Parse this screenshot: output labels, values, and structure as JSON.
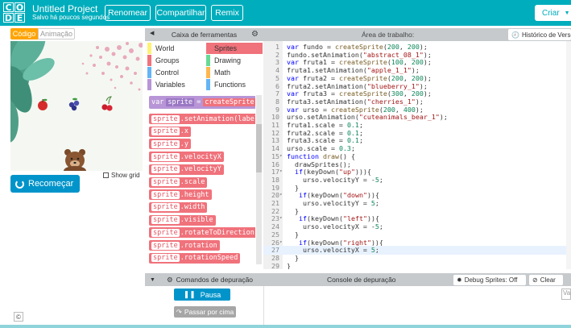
{
  "header": {
    "logo_letters": [
      "C",
      "O",
      "D",
      "E"
    ],
    "project_title": "Untitled Project",
    "project_status": "Salvo há poucos segundos",
    "buttons": {
      "renomear": "Renomear",
      "compartilhar": "Compartilhar",
      "remix": "Remix"
    },
    "create_label": "Criar"
  },
  "left": {
    "tab_code": "Código",
    "tab_animation": "Animação",
    "show_grid": "Show grid",
    "reset": "Recomeçar",
    "copyright": "©"
  },
  "toolbox": {
    "title": "Caixa de ferramentas",
    "categories": [
      {
        "label": "World",
        "color": "#fff176"
      },
      {
        "label": "Sprites",
        "color": "#f0727b"
      },
      {
        "label": "Groups",
        "color": "#f0727b"
      },
      {
        "label": "Drawing",
        "color": "#68d995"
      },
      {
        "label": "Control",
        "color": "#64b5f6"
      },
      {
        "label": "Math",
        "color": "#ffb74d"
      },
      {
        "label": "Variables",
        "color": "#b795d6"
      },
      {
        "label": "Functions",
        "color": "#64b5f6"
      }
    ],
    "var_block": {
      "keyword": "var",
      "name": "sprite",
      "eq": "=",
      "call": "createSprite("
    },
    "blocks": [
      {
        "obj": "sprite",
        "rest": ".setAnimation(label)"
      },
      {
        "obj": "sprite",
        "rest": ".x"
      },
      {
        "obj": "sprite",
        "rest": ".y"
      },
      {
        "obj": "sprite",
        "rest": ".velocityX"
      },
      {
        "obj": "sprite",
        "rest": ".velocityY"
      },
      {
        "obj": "sprite",
        "rest": ".scale"
      },
      {
        "obj": "sprite",
        "rest": ".height"
      },
      {
        "obj": "sprite",
        "rest": ".width"
      },
      {
        "obj": "sprite",
        "rest": ".visible"
      },
      {
        "obj": "sprite",
        "rest": ".rotateToDirection"
      },
      {
        "obj": "sprite",
        "rest": ".rotation"
      },
      {
        "obj": "sprite",
        "rest": ".rotationSpeed"
      }
    ]
  },
  "workspace": {
    "title": "Área de trabalho:",
    "history": "Histórico de Versões",
    "active_line": 27,
    "lines": [
      {
        "n": "1",
        "fold": "",
        "code": [
          [
            "k",
            "var"
          ],
          [
            "t",
            " fundo = "
          ],
          [
            "f",
            "createSprite"
          ],
          [
            "t",
            "("
          ],
          [
            "n",
            "200"
          ],
          [
            "t",
            ", "
          ],
          [
            "n",
            "200"
          ],
          [
            "t",
            ");"
          ]
        ]
      },
      {
        "n": "2",
        "fold": "",
        "code": [
          [
            "t",
            "fundo.setAnimation("
          ],
          [
            "s",
            "\"abstract_08_1\""
          ],
          [
            "t",
            ");"
          ]
        ]
      },
      {
        "n": "3",
        "fold": "",
        "code": [
          [
            "k",
            "var"
          ],
          [
            "t",
            " fruta1 = "
          ],
          [
            "f",
            "createSprite"
          ],
          [
            "t",
            "("
          ],
          [
            "n",
            "100"
          ],
          [
            "t",
            ", "
          ],
          [
            "n",
            "200"
          ],
          [
            "t",
            ");"
          ]
        ]
      },
      {
        "n": "4",
        "fold": "",
        "code": [
          [
            "t",
            "fruta1.setAnimation("
          ],
          [
            "s",
            "\"apple_1_1\""
          ],
          [
            "t",
            ");"
          ]
        ]
      },
      {
        "n": "5",
        "fold": "",
        "code": [
          [
            "k",
            "var"
          ],
          [
            "t",
            " fruta2 = "
          ],
          [
            "f",
            "createSprite"
          ],
          [
            "t",
            "("
          ],
          [
            "n",
            "200"
          ],
          [
            "t",
            ", "
          ],
          [
            "n",
            "200"
          ],
          [
            "t",
            ");"
          ]
        ]
      },
      {
        "n": "6",
        "fold": "",
        "code": [
          [
            "t",
            "fruta2.setAnimation("
          ],
          [
            "s",
            "\"blueberry_1\""
          ],
          [
            "t",
            ");"
          ]
        ]
      },
      {
        "n": "7",
        "fold": "",
        "code": [
          [
            "k",
            "var"
          ],
          [
            "t",
            " fruta3 = "
          ],
          [
            "f",
            "createSprite"
          ],
          [
            "t",
            "("
          ],
          [
            "n",
            "300"
          ],
          [
            "t",
            ", "
          ],
          [
            "n",
            "200"
          ],
          [
            "t",
            ");"
          ]
        ]
      },
      {
        "n": "8",
        "fold": "",
        "code": [
          [
            "t",
            "fruta3.setAnimation("
          ],
          [
            "s",
            "\"cherries_1\""
          ],
          [
            "t",
            ");"
          ]
        ]
      },
      {
        "n": "9",
        "fold": "",
        "code": [
          [
            "k",
            "var"
          ],
          [
            "t",
            " urso = "
          ],
          [
            "f",
            "createSprite"
          ],
          [
            "t",
            "("
          ],
          [
            "n",
            "200"
          ],
          [
            "t",
            ", "
          ],
          [
            "n",
            "400"
          ],
          [
            "t",
            ");"
          ]
        ]
      },
      {
        "n": "10",
        "fold": "",
        "code": [
          [
            "t",
            "urso.setAnimation("
          ],
          [
            "s",
            "\"cuteanimals_bear_1\""
          ],
          [
            "t",
            ");"
          ]
        ]
      },
      {
        "n": "11",
        "fold": "",
        "code": [
          [
            "t",
            "fruta1.scale = "
          ],
          [
            "n",
            "0.1"
          ],
          [
            "t",
            ";"
          ]
        ]
      },
      {
        "n": "12",
        "fold": "",
        "code": [
          [
            "t",
            "fruta2.scale = "
          ],
          [
            "n",
            "0.1"
          ],
          [
            "t",
            ";"
          ]
        ]
      },
      {
        "n": "13",
        "fold": "",
        "code": [
          [
            "t",
            "fruta3.scale = "
          ],
          [
            "n",
            "0.1"
          ],
          [
            "t",
            ";"
          ]
        ]
      },
      {
        "n": "14",
        "fold": "",
        "code": [
          [
            "t",
            "urso.scale = "
          ],
          [
            "n",
            "0.3"
          ],
          [
            "t",
            ";"
          ]
        ]
      },
      {
        "n": "15",
        "fold": "▾",
        "code": [
          [
            "k",
            "function"
          ],
          [
            "t",
            " "
          ],
          [
            "f",
            "draw"
          ],
          [
            "t",
            "() {"
          ]
        ]
      },
      {
        "n": "16",
        "fold": "",
        "code": [
          [
            "t",
            "  drawSprites();"
          ]
        ]
      },
      {
        "n": "17",
        "fold": "▾",
        "code": [
          [
            "t",
            "  "
          ],
          [
            "k",
            "if"
          ],
          [
            "t",
            "(keyDown("
          ],
          [
            "s",
            "\"up\""
          ],
          [
            "t",
            "))){"
          ]
        ]
      },
      {
        "n": "18",
        "fold": "",
        "code": [
          [
            "t",
            "    urso.velocityY = -"
          ],
          [
            "n",
            "5"
          ],
          [
            "t",
            ";"
          ]
        ]
      },
      {
        "n": "19",
        "fold": "",
        "code": [
          [
            "t",
            "  }"
          ]
        ]
      },
      {
        "n": "20",
        "fold": "▾",
        "code": [
          [
            "t",
            "   "
          ],
          [
            "k",
            "if"
          ],
          [
            "t",
            "(keyDown("
          ],
          [
            "s",
            "\"down\""
          ],
          [
            "t",
            ")){"
          ]
        ]
      },
      {
        "n": "21",
        "fold": "",
        "code": [
          [
            "t",
            "    urso.velocityY = "
          ],
          [
            "n",
            "5"
          ],
          [
            "t",
            ";"
          ]
        ]
      },
      {
        "n": "22",
        "fold": "",
        "code": [
          [
            "t",
            "  }"
          ]
        ]
      },
      {
        "n": "23",
        "fold": "▾",
        "code": [
          [
            "t",
            "   "
          ],
          [
            "k",
            "if"
          ],
          [
            "t",
            "(keyDown("
          ],
          [
            "s",
            "\"left\""
          ],
          [
            "t",
            ")){"
          ]
        ]
      },
      {
        "n": "24",
        "fold": "",
        "code": [
          [
            "t",
            "    urso.velocityX = -"
          ],
          [
            "n",
            "5"
          ],
          [
            "t",
            ";"
          ]
        ]
      },
      {
        "n": "25",
        "fold": "",
        "code": [
          [
            "t",
            "  }"
          ]
        ]
      },
      {
        "n": "26",
        "fold": "▾",
        "code": [
          [
            "t",
            "   "
          ],
          [
            "k",
            "if"
          ],
          [
            "t",
            "(keyDown("
          ],
          [
            "s",
            "\"right\""
          ],
          [
            "t",
            ")){"
          ]
        ]
      },
      {
        "n": "27",
        "fold": "",
        "code": [
          [
            "t",
            "    urso.velocityX = "
          ],
          [
            "n",
            "5"
          ],
          [
            "t",
            ";"
          ]
        ]
      },
      {
        "n": "28",
        "fold": "",
        "code": [
          [
            "t",
            "  }"
          ]
        ]
      },
      {
        "n": "29",
        "fold": "",
        "code": [
          [
            "t",
            "}"
          ]
        ]
      },
      {
        "n": "30",
        "fold": "",
        "code": []
      }
    ]
  },
  "debug": {
    "commands_title": "Comandos de depuração",
    "console_title": "Console de depuração",
    "debug_sprites": "Debug Sprites: Off",
    "clear": "Clear",
    "pause": "Pausa",
    "step_over": "Passar por cima",
    "console_input_placeholder": "Va"
  },
  "colors": {
    "brand": "#00adbc",
    "accent": "#ffa400",
    "button_blue": "#0094ca",
    "block_red": "#f0727b"
  }
}
